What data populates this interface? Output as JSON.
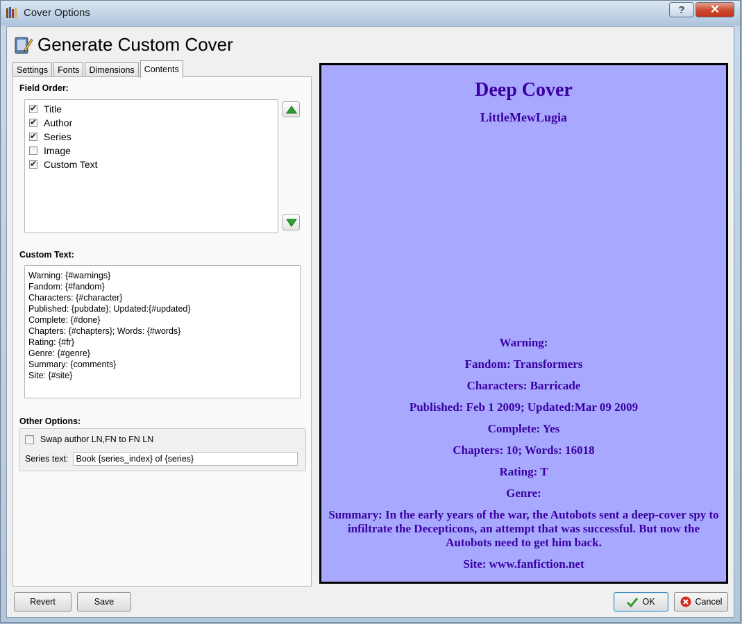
{
  "window": {
    "title": "Cover Options",
    "help_label": "?",
    "close_label": "✕"
  },
  "heading": "Generate Custom Cover",
  "tabs": [
    {
      "label": "Settings"
    },
    {
      "label": "Fonts"
    },
    {
      "label": "Dimensions"
    },
    {
      "label": "Contents",
      "active": true
    }
  ],
  "field_order": {
    "label": "Field Order:",
    "items": [
      {
        "label": "Title",
        "checked": true
      },
      {
        "label": "Author",
        "checked": true
      },
      {
        "label": "Series",
        "checked": true
      },
      {
        "label": "Image",
        "checked": false
      },
      {
        "label": "Custom Text",
        "checked": true
      }
    ]
  },
  "custom_text": {
    "label": "Custom Text:",
    "lines": [
      "Warning: {#warnings}",
      "Fandom: {#fandom}",
      "Characters: {#character}",
      "Published: {pubdate}; Updated:{#updated}",
      "Complete: {#done}",
      "Chapters: {#chapters}; Words: {#words}",
      "Rating: {#fr}",
      "Genre: {#genre}",
      "Summary: {comments}",
      "Site: {#site}"
    ]
  },
  "other_options": {
    "label": "Other Options:",
    "swap_label": "Swap author LN,FN to FN LN",
    "swap_checked": false,
    "series_label": "Series text:",
    "series_value": "Book {series_index} of {series}"
  },
  "preview": {
    "title": "Deep Cover",
    "author": "LittleMewLugia",
    "lines": [
      "Warning:",
      "Fandom: Transformers",
      "Characters: Barricade",
      "Published: Feb 1 2009; Updated:Mar 09 2009",
      "Complete: Yes",
      "Chapters: 10; Words: 16018",
      "Rating: T",
      "Genre:",
      "Summary: In the early years of the war, the Autobots sent a deep-cover spy to infiltrate the Decepticons, an attempt that was successful. But now the Autobots need to get him back.",
      "Site: www.fanfiction.net"
    ],
    "background": "#a8a8ff",
    "text_color": "#3a00a0"
  },
  "buttons": {
    "revert": "Revert",
    "save": "Save",
    "ok": "OK",
    "cancel": "Cancel"
  }
}
